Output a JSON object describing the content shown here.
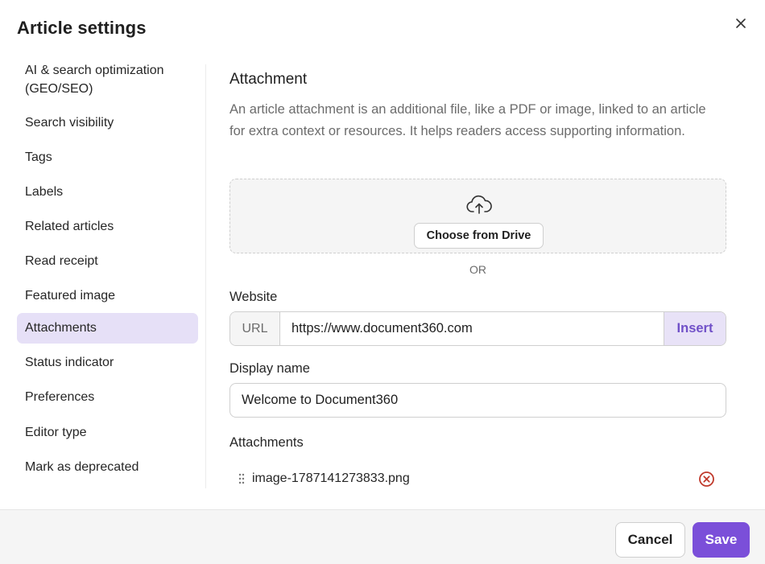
{
  "modal": {
    "title": "Article settings",
    "close_icon": "close-icon"
  },
  "sidebar": {
    "active_index": 7,
    "active_color": "#e6e0f7",
    "items": [
      {
        "label": "AI & search optimization (GEO/SEO)"
      },
      {
        "label": "Search visibility"
      },
      {
        "label": "Tags"
      },
      {
        "label": "Labels"
      },
      {
        "label": "Related articles"
      },
      {
        "label": "Read receipt"
      },
      {
        "label": "Featured image"
      },
      {
        "label": "Attachments"
      },
      {
        "label": "Status indicator"
      },
      {
        "label": "Preferences"
      },
      {
        "label": "Editor type"
      },
      {
        "label": "Mark as deprecated"
      }
    ]
  },
  "attachment": {
    "title": "Attachment",
    "description": "An article attachment is an additional file, like a PDF or image, linked to an article for extra context or resources. It helps readers access supporting information.",
    "upload_icon": "cloud-upload-icon",
    "choose_drive_label": "Choose from Drive",
    "or_label": "OR"
  },
  "website": {
    "label": "Website",
    "prefix": "URL",
    "value": "https://www.document360.com",
    "insert_label": "Insert"
  },
  "display_name": {
    "label": "Display name",
    "value": "Welcome to Document360"
  },
  "attachments_list": {
    "label": "Attachments",
    "items": [
      {
        "file_name": "image-1787141273833.png",
        "drag_icon": "drag-handle-icon",
        "remove_icon": "remove-circle-icon"
      }
    ]
  },
  "footer": {
    "cancel_label": "Cancel",
    "save_label": "Save"
  },
  "colors": {
    "accent": "#7b4fd9",
    "insert_text": "#7050c8",
    "remove_icon": "#c0392b"
  }
}
